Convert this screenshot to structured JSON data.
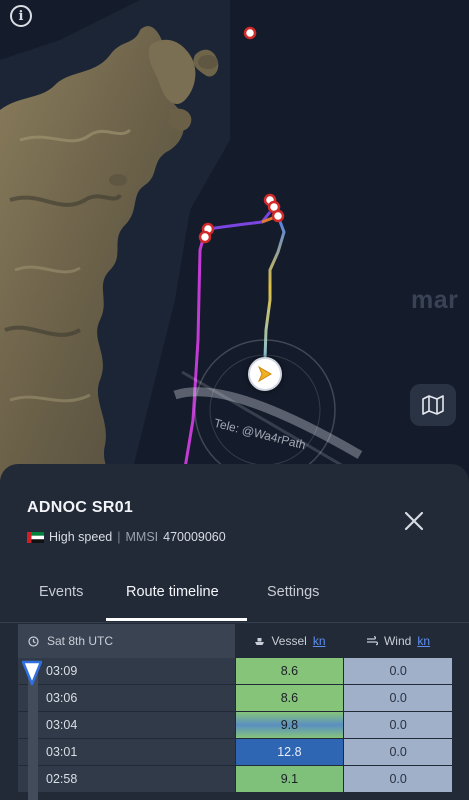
{
  "map": {
    "brand_watermark": "mar",
    "tele_stamp": "Tele: @Wa4rPath",
    "icons": {
      "info": "info-icon",
      "layers": "map-layers-icon",
      "vessel": "vessel-arrow-icon"
    }
  },
  "vessel": {
    "name": "ADNOC SR01",
    "flag_country": "United Arab Emirates",
    "status": "High speed",
    "mmsi_label": "MMSI",
    "mmsi": "470009060"
  },
  "tabs": [
    {
      "label": "Events",
      "active": false
    },
    {
      "label": "Route timeline",
      "active": true
    },
    {
      "label": "Settings",
      "active": false
    }
  ],
  "timeline": {
    "date_label": "Sat 8th UTC",
    "vessel_col": "Vessel",
    "vessel_unit": "kn",
    "wind_col": "Wind",
    "wind_unit": "kn",
    "rows": [
      {
        "time": "03:09",
        "vessel": "8.6",
        "wind": "0.0"
      },
      {
        "time": "03:06",
        "vessel": "8.6",
        "wind": "0.0"
      },
      {
        "time": "03:04",
        "vessel": "9.8",
        "wind": "0.0"
      },
      {
        "time": "03:01",
        "vessel": "12.8",
        "wind": "0.0"
      },
      {
        "time": "02:58",
        "vessel": "9.1",
        "wind": "0.0"
      }
    ]
  },
  "colors": {
    "speed_low": "#86c47a",
    "speed_mid": "#5a8fc2",
    "speed_high": "#2f66b3",
    "wind": "#9fb0c8",
    "route_pink": "#c23bd4",
    "route_purple": "#7a45e0"
  }
}
